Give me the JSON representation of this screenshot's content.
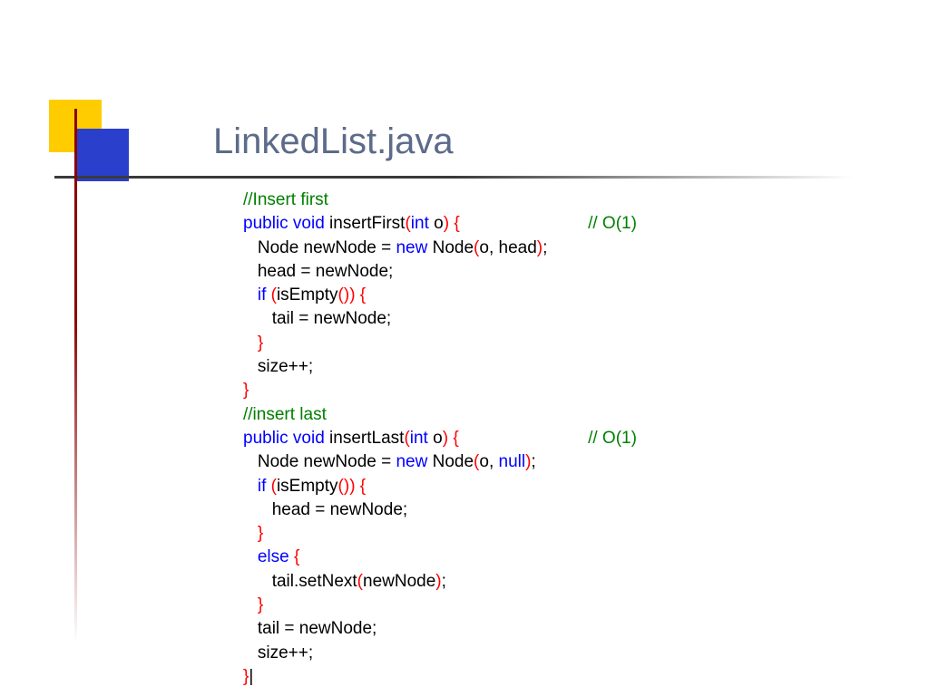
{
  "title": "LinkedList.java",
  "c": {
    "c1": "//Insert first",
    "pv": "public void",
    "m1": " insertFirst",
    "lp": "(",
    "int": "int",
    "po": " o",
    "rp": ")",
    "sp": " ",
    "lb": "{",
    "cplx1": "// O(1)",
    "l2": "Node newNode = ",
    "new": "new",
    "l2b": " Node",
    "l2c": "o, head",
    "rp2": ")",
    "semi": ";",
    "l3": "head = newNode;",
    "if": "if",
    "ise": "isEmpty",
    "pp": "()",
    "l5": "tail = newNode;",
    "rb": "}",
    "sz": "size++;",
    "c2": "//insert last",
    "m2": " insertLast",
    "l10c": "o, ",
    "null": "null",
    "l12": "head = newNode;",
    "else": "else",
    "l15a": "tail.setNext",
    "l15b": "newNode",
    "l16": "tail = newNode;"
  }
}
